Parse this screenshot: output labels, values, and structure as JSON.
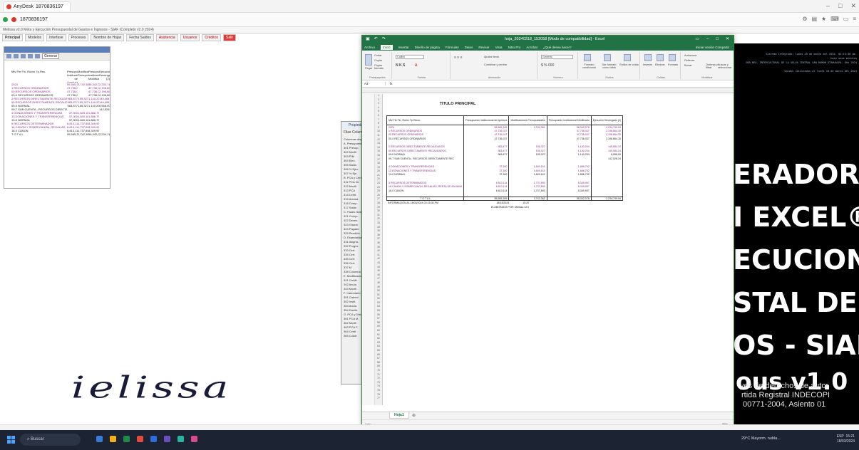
{
  "anydesk": {
    "app_name": "AnyDesk",
    "tab_label": "1870836197",
    "address": "1870836197",
    "cursor_hint": ""
  },
  "siaf": {
    "window_title": "Melissa v2.0 Meta y Ejecución Presupuestal de Gastos e Ingresos - SIAF (Completo v2.0 2024)",
    "menu": [
      "Principal",
      "Modelos",
      "Interfase",
      "Procesos",
      "Nombre de Hojas",
      "Fecha Saldos",
      "Asistencia",
      "Usuarios",
      "Créditos",
      "Salir"
    ],
    "generar_label": "Generar",
    "minisheet": [
      {
        "label": "Mtv  Fte Fin.  Rubro  Tp.Rec.",
        "v": [
          "Presupuesto Institucional de Apertura",
          "Modificaciones Presupuestales",
          "Presupuesto Institucional Modificado",
          "Ejecución Devengado (2)"
        ],
        "cls": ""
      },
      {
        "label": "2024",
        "v": [
          "55,565,399",
          "2,742,381",
          "58,342,078",
          "2,234,749.54"
        ],
        "cls": "purple"
      },
      {
        "label": "1  RECURSOS ORDINARIOS",
        "v": [
          "47,736,037",
          "",
          "47,736,037",
          "2,196,664.30"
        ],
        "cls": "purple"
      },
      {
        "label": "00  RECURSOS ORDINARIOS",
        "v": [
          "47,736,037",
          "",
          "47,736,037",
          "2,196,664.30"
        ],
        "cls": "purple"
      },
      {
        "label": "00-0  RECURSOS ORDINARIOS",
        "v": [
          "47,736,037",
          "",
          "47,736,037",
          "2,196,664.30"
        ],
        "cls": ""
      },
      {
        "label": "2  RECURSOS DIRECTAMENTE RECAUDADOS",
        "v": [
          "983,877",
          "155,327",
          "1,140,204",
          "149,084.24"
        ],
        "cls": "purple"
      },
      {
        "label": "09  RECURSOS DIRECTAMENTE RECAUDADOS",
        "v": [
          "983,877",
          "155,327",
          "1,140,204",
          "149,084.24"
        ],
        "cls": "purple"
      },
      {
        "label": "09-0  NORMAL",
        "v": [
          "983,877",
          "155,327",
          "1,140,204",
          "6,556.00"
        ],
        "cls": ""
      },
      {
        "label": "09-7  SUB CUENTA - RECURSOS DIRECTAMENTE REC",
        "v": [
          "",
          "",
          "",
          "142,528.24"
        ],
        "cls": ""
      },
      {
        "label": "4  DONACIONES Y TRANSFERENCIAS",
        "v": [
          "37,300",
          "1,849,161",
          "1,886,792",
          ""
        ],
        "cls": "purple"
      },
      {
        "label": "13  DONACIONES Y TRANSFERENCIAS",
        "v": [
          "37,300",
          "1,849,161",
          "1,886,792",
          ""
        ],
        "cls": "purple"
      },
      {
        "label": "13-0  NORMAL",
        "v": [
          "37,300",
          "1,849,161",
          "1,886,792",
          ""
        ],
        "cls": ""
      },
      {
        "label": "5  RECURSOS DETERMINADOS",
        "v": [
          "6,813,114",
          "1,737,893",
          "8,349,997",
          ""
        ],
        "cls": "purple"
      },
      {
        "label": "18  CANON Y SOBRECANON, REGALIAS, RENTA DE ADUANA",
        "v": [
          "6,813,114",
          "1,737,893",
          "8,349,997",
          ""
        ],
        "cls": "purple"
      },
      {
        "label": "18-0  CANON",
        "v": [
          "6,813,114",
          "1,737,893",
          "8,349,997",
          ""
        ],
        "cls": ""
      },
      {
        "label": "T O T A L",
        "v": [
          "55,565,399",
          "2,742,381",
          "58,342,078",
          "2,234,749.54"
        ],
        "cls": ""
      }
    ],
    "props_title": "Propiedades",
    "props_tabs": "Filas  Columnas",
    "props_items": [
      "Columnas disponibles",
      "A. Presupuesto",
      "301 Presup.",
      "302 Modif.",
      "303 PIM",
      "304 Ejec.",
      "305 Saldo",
      "306 % Ejec.",
      "307 % Eje.",
      "B. PCA y Cert.",
      "311 PCA Ini.",
      "312 Modif.",
      "313 PCA",
      "314 Certif.",
      "315 Anulad.",
      "316 Comp.",
      "317 Saldo",
      "C. Fases Gasto",
      "321 Compr.",
      "322 Deven.",
      "323 Girado",
      "324 Pagado",
      "325 Rendido",
      "D. Especialidad",
      "331 Asigna.",
      "332 Progra.",
      "333 Cert.",
      "334 Cert.",
      "335 Cert.",
      "336 Cert.",
      "337 M",
      "338 Columna",
      "E. Modificaciones",
      "341 Crédit.",
      "342 Anula.",
      "343 Modif.",
      "F. Calendario",
      "351 Calend.",
      "352 Instit.",
      "353 Anula.",
      "354 Distrib.",
      "G. PCA y Dist.",
      "361 PCA M.",
      "362 Modif.",
      "363 PCA F.",
      "364 Certif.",
      "365 Cuadr."
    ]
  },
  "excel": {
    "doc_title": "hoja_20240318_152058 [Modo de compatibilidad] - Excel",
    "tabs": [
      "Archivo",
      "Inicio",
      "Insertar",
      "Diseño de página",
      "Fórmulas",
      "Datos",
      "Revisar",
      "Vista",
      "Nitro Pro",
      "Acrobat",
      "¿Qué desea hacer?"
    ],
    "active_tab": "Inicio",
    "login": "Iniciar sesión  Compartir",
    "ribbon_groups": [
      "Portapapeles",
      "Fuente",
      "Alineación",
      "Número",
      "Estilos",
      "Celdas",
      "Modificar"
    ],
    "ribbon_items": {
      "cut": "Cortar",
      "copy": "Copiar",
      "paste": "Pegar",
      "format_painter": "Copiar formato",
      "font": "Calibri",
      "wrap": "Ajustar texto",
      "merge": "Combinar y centrar",
      "number_format": "General",
      "cond_format": "Formato condicional",
      "table_format": "Dar formato como tabla",
      "cell_styles": "Estilos de celda",
      "insert": "Insertar",
      "delete": "Eliminar",
      "format": "Formato",
      "autosum": "Autosuma",
      "fill": "Rellenar",
      "clear": "Borrar",
      "sort": "Ordenar y filtrar",
      "find": "Buscar y seleccionar"
    },
    "name_box": "A3",
    "fx": "fx",
    "sheet_title": "TITULO PRINCIPAL",
    "headers": [
      "Mtv  Fte Fin.  Rubro  Tp.Recur.",
      "Presupuesto Institucional de Apertura",
      "Modificaciones Presupuestales",
      "Presupuesto Institucional Modificado",
      "Ejecución Devengado (2)"
    ],
    "rows": [
      {
        "label": "2024",
        "v": [
          "55,565,399",
          "2,742,381",
          "58,342,078",
          "2,234,749.54"
        ],
        "cls": "purple"
      },
      {
        "label": "1  RECURSOS ORDINARIOS",
        "v": [
          "47,736,037",
          "",
          "47,736,037",
          "2,196,664.30"
        ],
        "cls": "purple"
      },
      {
        "label": "00  RECURSOS ORDINARIOS",
        "v": [
          "47,736,037",
          "",
          "47,736,037",
          "2,196,664.30"
        ],
        "cls": "purple"
      },
      {
        "label": "00-0  RECURSOS ORDINARIOS",
        "v": [
          "47,736,037",
          "",
          "47,736,037",
          "2,196,664.30"
        ],
        "cls": ""
      },
      {
        "label": "",
        "v": [
          "",
          "",
          "",
          ""
        ],
        "cls": ""
      },
      {
        "label": "2  RECURSOS DIRECTAMENTE RECAUDADOS",
        "v": [
          "983,877",
          "155,327",
          "1,140,204",
          "149,084.24"
        ],
        "cls": "purple"
      },
      {
        "label": "09  RECURSOS DIRECTAMENTE RECAUDADOS",
        "v": [
          "983,877",
          "155,327",
          "1,140,204",
          "149,084.24"
        ],
        "cls": "purple"
      },
      {
        "label": "09-0  NORMAL",
        "v": [
          "983,877",
          "155,327",
          "1,140,204",
          "6,556.00"
        ],
        "cls": ""
      },
      {
        "label": "09-7  SUB CUENTA - RECURSOS DIRECTAMENTE REC",
        "v": [
          "",
          "",
          "",
          "142,528.24"
        ],
        "cls": ""
      },
      {
        "label": "",
        "v": [
          "",
          "",
          "",
          ""
        ],
        "cls": ""
      },
      {
        "label": "4  DONACIONES Y TRANSFERENCIAS",
        "v": [
          "37,300",
          "1,849,161",
          "1,886,792",
          ""
        ],
        "cls": "purple"
      },
      {
        "label": "13  DONACIONES Y TRANSFERENCIAS",
        "v": [
          "37,300",
          "1,849,161",
          "1,886,792",
          ""
        ],
        "cls": "purple"
      },
      {
        "label": "13-0  NORMAL",
        "v": [
          "37,300",
          "1,849,161",
          "1,886,792",
          ""
        ],
        "cls": ""
      },
      {
        "label": "",
        "v": [
          "",
          "",
          "",
          ""
        ],
        "cls": ""
      },
      {
        "label": "5  RECURSOS DETERMINADOS",
        "v": [
          "6,813,114",
          "1,737,893",
          "8,349,997",
          ""
        ],
        "cls": "purple"
      },
      {
        "label": "18  CANON Y SOBRECANON, REGALIAS, RENTA DE ADUANA",
        "v": [
          "6,813,114",
          "1,737,893",
          "8,349,997",
          ""
        ],
        "cls": "purple"
      },
      {
        "label": "18-0  CANON",
        "v": [
          "6,813,114",
          "1,737,893",
          "8,349,997",
          ""
        ],
        "cls": ""
      },
      {
        "label": "",
        "v": [
          "",
          "",
          "",
          ""
        ],
        "cls": ""
      },
      {
        "label": "T O T A L",
        "v": [
          "55,565,399",
          "2,742,381",
          "58,342,078",
          "2,234,749.54"
        ],
        "cls": ""
      }
    ],
    "footer_left": "INFORMACIÓN AL 18/03/2024 03:15:30 PM",
    "footer_date": "18/03/2024",
    "footer_time": "15:20",
    "footer_by": "ELABORADO POR: Melissa v2.0",
    "sheet_tab": "Hoja1",
    "status": "Listo",
    "zoom": "85%"
  },
  "banner": {
    "info_lines": [
      "Sistema Integrado: lunes 18 de marzo del 2024, 03:15:30 pm.",
      "hace unos minutos",
      "GOB.REG. INTERCULTURAL DE LA SELVA CENTRAL SAN RAMON ATAHUALPA. Año 2024",
      "Saldos calculados al lunes 18 de marzo del 2024"
    ],
    "big_lines": [
      "ERADOR",
      "I EXCEL®",
      "ECUCION",
      "STAL DE",
      "OS - SIAF"
    ],
    "version": "ous v1.0",
    "copyright": [
      "yes de derechos de autor",
      "rtida Registral INDECOPI",
      "00771-2004, Asiento 01"
    ]
  },
  "watermark": "ielissa",
  "taskbar": {
    "search": "Buscar",
    "weather": "29°C  Mayorm. nubla...",
    "time": "15:21",
    "date": "18/03/2024",
    "lang": "ESP"
  }
}
